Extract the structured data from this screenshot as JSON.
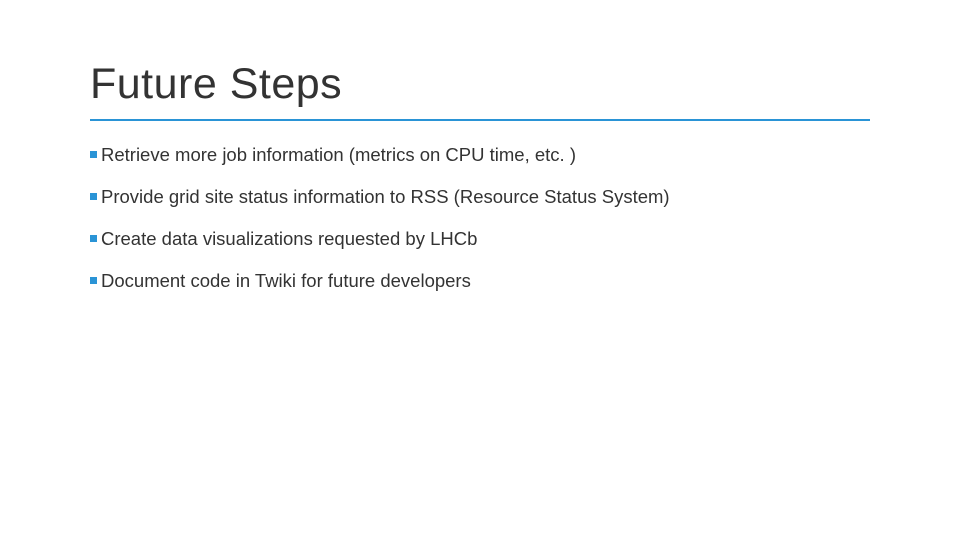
{
  "slide": {
    "title": "Future Steps",
    "bullets": [
      "Retrieve more job information (metrics on CPU time, etc. )",
      "Provide grid site status information to RSS (Resource Status System)",
      "Create data visualizations requested by LHCb",
      "Document code in Twiki for future developers"
    ]
  }
}
